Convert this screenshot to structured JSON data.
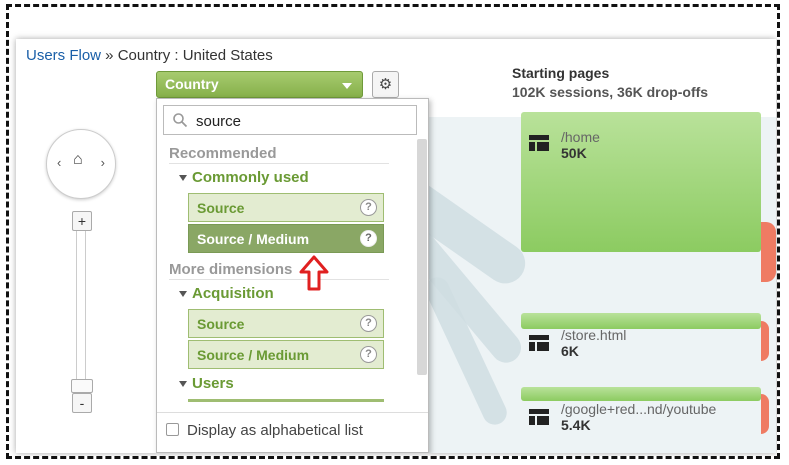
{
  "breadcrumb": {
    "link": "Users Flow",
    "separator": " » ",
    "current": "Country : United States"
  },
  "dimension_button": {
    "label": "Country",
    "caret_icon": "caret-down-icon"
  },
  "settings": {
    "icon": "gear-icon"
  },
  "nav": {
    "left": "‹",
    "home": "⌂",
    "right": "›",
    "zoom_in": "+",
    "zoom_out": "-"
  },
  "dropdown": {
    "search": {
      "value": "source",
      "placeholder": ""
    },
    "recommended_title": "Recommended",
    "commonly_used_title": "Commonly used",
    "commonly_used_items": [
      "Source",
      "Source / Medium"
    ],
    "selected_item": "Source / Medium",
    "more_dimensions_title": "More dimensions",
    "acquisition_title": "Acquisition",
    "acquisition_items": [
      "Source",
      "Source / Medium"
    ],
    "users_title": "Users",
    "help_glyph": "?",
    "footer_label": "Display as alphabetical list",
    "footer_checked": false
  },
  "column": {
    "title": "Starting pages",
    "subtitle": "102K sessions, 36K drop-offs"
  },
  "nodes": [
    {
      "name": "/home",
      "value": "50K"
    },
    {
      "name": "/store.html",
      "value": "6K"
    },
    {
      "name": "/google+red...nd/youtube",
      "value": "5.4K"
    }
  ],
  "colors": {
    "node_green": "#8ccb61",
    "dimension_green": "#86b04a",
    "dropoff": "#ef7b63",
    "highlight_arrow": "#e02020"
  }
}
